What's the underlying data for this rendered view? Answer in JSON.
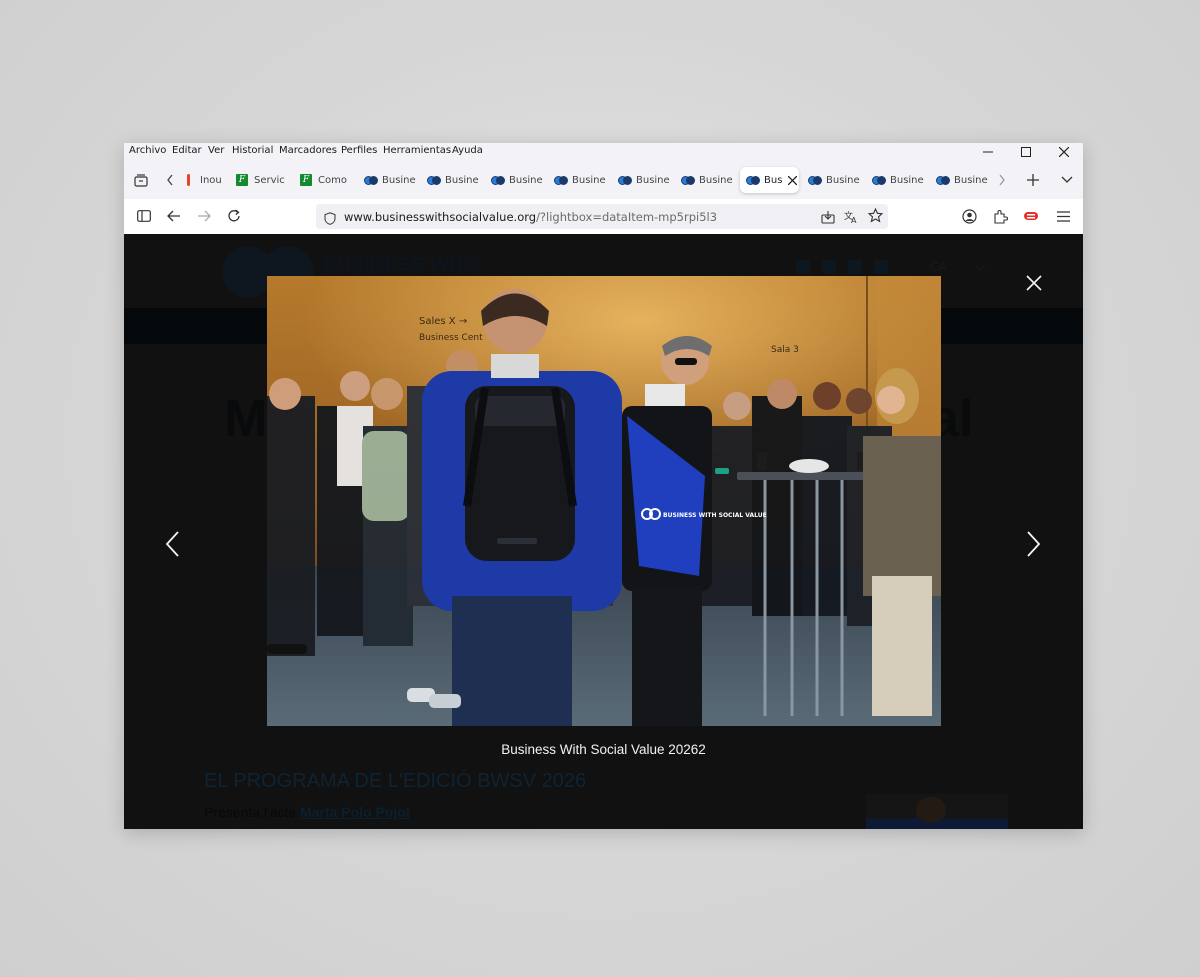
{
  "menubar": {
    "items": [
      "Archivo",
      "Editar",
      "Ver",
      "Historial",
      "Marcadores",
      "Perfiles",
      "Herramientas",
      "Ayuda"
    ]
  },
  "tabs": [
    {
      "label": "Inout",
      "favicon": "red-bar-icon"
    },
    {
      "label": "Servic",
      "favicon": "f-green-icon"
    },
    {
      "label": "Como",
      "favicon": "f-green-icon"
    },
    {
      "label": "Busine",
      "favicon": "bwsv-icon"
    },
    {
      "label": "Busine",
      "favicon": "bwsv-icon"
    },
    {
      "label": "Busine",
      "favicon": "bwsv-icon"
    },
    {
      "label": "Busine",
      "favicon": "bwsv-icon"
    },
    {
      "label": "Busine",
      "favicon": "bwsv-icon"
    },
    {
      "label": "Busine",
      "favicon": "bwsv-icon"
    },
    {
      "label": "Bus",
      "favicon": "bwsv-icon",
      "active": true
    },
    {
      "label": "Busine",
      "favicon": "bwsv-icon"
    },
    {
      "label": "Busine",
      "favicon": "bwsv-icon"
    },
    {
      "label": "Busine",
      "favicon": "bwsv-icon"
    }
  ],
  "urlbar": {
    "host": "www.businesswithsocialvalue.org",
    "path": "/?lightbox=dataItem-mp5rpi5l3"
  },
  "site": {
    "logo_text": "BUSINESS WITH",
    "language": "CA",
    "heading_left": "M",
    "heading_right": "al",
    "program_title": "EL PROGRAMA DE L'EDICIÓ BWSV 2026",
    "presenter_prefix": "Presenta l'acte ",
    "presenter_name": "Marta Polo Pujol",
    "presenter_suffix": "."
  },
  "lightbox": {
    "caption": "Business With Social Value 20262",
    "bag_text": "BUSINESS WITH SOCIAL VALUE",
    "sign_text_1": "Sales X →",
    "sign_text_2": "Business Cent",
    "sign_text_3": "Sala 3"
  },
  "colors": {
    "overlay": "#111111",
    "chrome": "#f3f2f7",
    "accent_blue": "#1f3fbf"
  }
}
